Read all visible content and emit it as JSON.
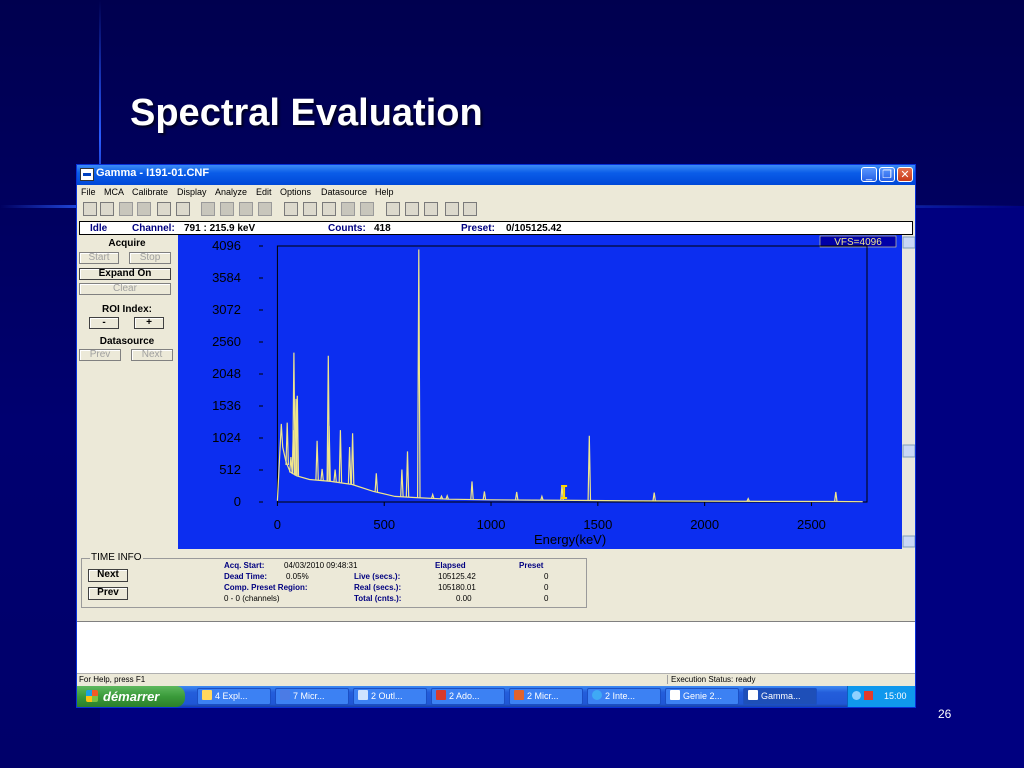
{
  "slide": {
    "title": "Spectral Evaluation",
    "page_number": "26"
  },
  "window": {
    "title": "Gamma - I191-01.CNF",
    "min_label": "_",
    "max_label": "❐",
    "close_label": "✕"
  },
  "menu": [
    "File",
    "MCA",
    "Calibrate",
    "Display",
    "Analyze",
    "Edit",
    "Options",
    "Datasource",
    "Help"
  ],
  "status_row": {
    "state": "Idle",
    "channel_label": "Channel:",
    "channel_value": "791  :  215.9 keV",
    "counts_label": "Counts:",
    "counts_value": "418",
    "preset_label": "Preset:",
    "preset_value": "0/105125.42"
  },
  "left_panel": {
    "acquire_heading": "Acquire",
    "start": "Start",
    "stop": "Stop",
    "expand": "Expand On",
    "clear": "Clear",
    "roi_heading": "ROI Index:",
    "roi_minus": "-",
    "roi_plus": "+",
    "datasource_heading": "Datasource",
    "prev": "Prev",
    "next": "Next"
  },
  "chart_data": {
    "type": "line",
    "xlabel": "Energy(keV)",
    "ylabel": "",
    "xlim": [
      -30,
      2760
    ],
    "ylim": [
      0,
      4096
    ],
    "x_ticks": [
      0,
      500,
      1000,
      1500,
      2000,
      2500
    ],
    "y_ticks": [
      0,
      512,
      1024,
      1536,
      2048,
      2560,
      3072,
      3584,
      4096
    ],
    "vfs_label": "VFS=4096",
    "background_color": "#0c2ef0",
    "trace_color": "#f0e68c",
    "continuum": [
      [
        0,
        20
      ],
      [
        18,
        1250
      ],
      [
        25,
        880
      ],
      [
        40,
        640
      ],
      [
        60,
        480
      ],
      [
        90,
        420
      ],
      [
        150,
        360
      ],
      [
        250,
        330
      ],
      [
        350,
        280
      ],
      [
        450,
        170
      ],
      [
        550,
        90
      ],
      [
        650,
        70
      ],
      [
        800,
        45
      ],
      [
        1000,
        35
      ],
      [
        1200,
        30
      ],
      [
        1400,
        25
      ],
      [
        1700,
        18
      ],
      [
        2000,
        14
      ],
      [
        2300,
        10
      ],
      [
        2614,
        8
      ],
      [
        2740,
        5
      ]
    ],
    "peaks": [
      {
        "energy": 46,
        "counts": 1270
      },
      {
        "energy": 63,
        "counts": 720
      },
      {
        "energy": 75,
        "counts": 1150
      },
      {
        "energy": 77,
        "counts": 2390
      },
      {
        "energy": 87,
        "counts": 1650
      },
      {
        "energy": 93,
        "counts": 1700
      },
      {
        "energy": 186,
        "counts": 980
      },
      {
        "energy": 209,
        "counts": 530
      },
      {
        "energy": 238,
        "counts": 2340
      },
      {
        "energy": 242,
        "counts": 1220
      },
      {
        "energy": 270,
        "counts": 520
      },
      {
        "energy": 295,
        "counts": 1150
      },
      {
        "energy": 338,
        "counts": 880
      },
      {
        "energy": 352,
        "counts": 1100
      },
      {
        "energy": 463,
        "counts": 460
      },
      {
        "energy": 583,
        "counts": 520
      },
      {
        "energy": 609,
        "counts": 810
      },
      {
        "energy": 662,
        "counts": 4040
      },
      {
        "energy": 727,
        "counts": 120
      },
      {
        "energy": 768,
        "counts": 95
      },
      {
        "energy": 795,
        "counts": 100
      },
      {
        "energy": 911,
        "counts": 330
      },
      {
        "energy": 969,
        "counts": 170
      },
      {
        "energy": 1120,
        "counts": 160
      },
      {
        "energy": 1238,
        "counts": 90
      },
      {
        "energy": 1332,
        "counts": 270
      },
      {
        "energy": 1460,
        "counts": 1060
      },
      {
        "energy": 1764,
        "counts": 150
      },
      {
        "energy": 2204,
        "counts": 55
      },
      {
        "energy": 2614,
        "counts": 160
      }
    ],
    "marker_energy": 1342
  },
  "time_info": {
    "heading": "TIME INFO",
    "next_button": "Next",
    "prev_button": "Prev",
    "acq_start_label": "Acq. Start:",
    "acq_start_value": "04/03/2010  09:48:31",
    "dead_time_label": "Dead Time:",
    "dead_time_value": "0.05%",
    "comp_preset_label": "Comp. Preset Region:",
    "channels_value": "0 - 0 (channels)",
    "elapsed_header": "Elapsed",
    "preset_header": "Preset",
    "live_label": "Live (secs.):",
    "live_elapsed": "105125.42",
    "live_preset": "0",
    "real_label": "Real (secs.):",
    "real_elapsed": "105180.01",
    "real_preset": "0",
    "total_label": "Total (cnts.):",
    "total_elapsed": "0.00",
    "total_preset": "0",
    "acq_preset": "0"
  },
  "status_bar": {
    "help": "For Help, press F1",
    "execution": "Execution Status: ready"
  },
  "taskbar": {
    "start_label": "démarrer",
    "tasks": [
      "4 Expl...",
      "7 Micr...",
      "2 Outl...",
      "2 Ado...",
      "2 Micr...",
      "2 Inte...",
      "Genie 2...",
      "Gamma..."
    ],
    "clock": "15:00"
  }
}
